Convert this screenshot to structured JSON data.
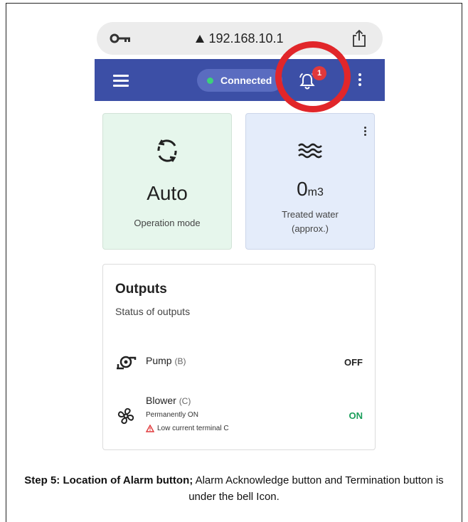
{
  "browser": {
    "url": "192.168.10.1"
  },
  "appbar": {
    "status_label": "Connected",
    "alarm_count": "1",
    "colors": {
      "bar": "#3c4fa6",
      "status_dot": "#3cd17a",
      "badge": "#e0393b"
    }
  },
  "cards": {
    "mode": {
      "value": "Auto",
      "label": "Operation mode",
      "icon": "sync-icon"
    },
    "water": {
      "value": "0",
      "unit": "m3",
      "label_line1": "Treated water",
      "label_line2": "(approx.)",
      "icon": "water-waves-icon"
    }
  },
  "outputs": {
    "title": "Outputs",
    "subtitle": "Status of outputs",
    "items": [
      {
        "name": "Pump",
        "code": "(B)",
        "state": "OFF",
        "icon": "pump-icon"
      },
      {
        "name": "Blower",
        "code": "(C)",
        "detail": "Permanently ON",
        "warning": "Low current terminal C",
        "state": "ON",
        "icon": "fan-icon"
      }
    ]
  },
  "caption": {
    "bold": "Step 5: Location of Alarm button;",
    "text": " Alarm Acknowledge button and Termination button is under the bell Icon."
  }
}
